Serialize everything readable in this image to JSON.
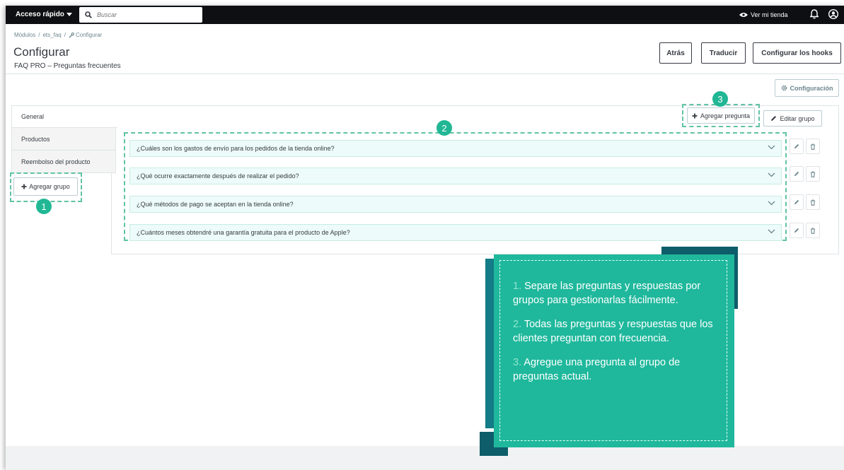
{
  "topbar": {
    "quick_access": "Acceso rápido",
    "search_placeholder": "Buscar",
    "view_store": "Ver mi tienda"
  },
  "breadcrumb": [
    "Módulos",
    "/",
    "ets_faq",
    "/",
    "Configurar"
  ],
  "header": {
    "title": "Configurar",
    "subtitle": "FAQ PRO – Preguntas frecuentes",
    "back": "Atrás",
    "translate": "Traducir",
    "hooks": "Configurar los hooks"
  },
  "config_button": "Configuración",
  "groups": [
    "General",
    "Productos",
    "Reembolso del producto"
  ],
  "add_group": "Agregar grupo",
  "add_question": "Agregar pregunta",
  "edit_group": "Editar grupo",
  "questions": [
    "¿Cuáles son los gastos de envío para los pedidos de la tienda online?",
    "¿Qué ocurre exactamente después de realizar el pedido?",
    "¿Qué métodos de pago se aceptan en la tienda online?",
    "¿Cuántos meses obtendré una garantía gratuita para el producto de Apple?"
  ],
  "badges": [
    "1",
    "2",
    "3"
  ],
  "notes": [
    {
      "num": "1.",
      "text": " Separe las preguntas y respuestas por grupos para gestionarlas fácilmente."
    },
    {
      "num": "2.",
      "text": " Todas las preguntas y respuestas que los clientes preguntan con frecuencia."
    },
    {
      "num": "3.",
      "text": " Agregue una pregunta al grupo de preguntas actual."
    }
  ],
  "colors": {
    "accent": "#21b794",
    "dashed": "#60c3a4",
    "callout": "#1fb89c",
    "callout_shadow": "#0e5d6a",
    "question_bg": "#edfbfa"
  }
}
